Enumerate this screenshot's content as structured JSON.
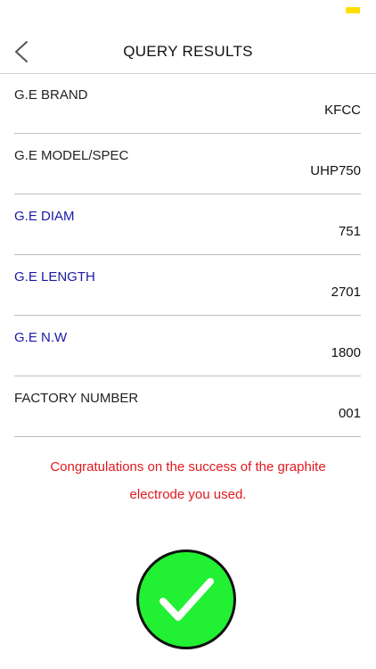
{
  "nav": {
    "title": "QUERY RESULTS",
    "back_icon": "chevron-left-icon"
  },
  "rows": [
    {
      "label": "G.E BRAND",
      "value": "KFCC",
      "label_color": "#222222"
    },
    {
      "label": "G.E MODEL/SPEC",
      "value": "UHP750",
      "label_color": "#222222"
    },
    {
      "label": "G.E DIAM",
      "value": "751",
      "label_color": "#1a1aa6"
    },
    {
      "label": "G.E LENGTH",
      "value": "2701",
      "label_color": "#1a1aa6"
    },
    {
      "label": "G.E N.W",
      "value": "1800",
      "label_color": "#1a1aa6"
    },
    {
      "label": "FACTORY NUMBER",
      "value": "001",
      "label_color": "#222222"
    }
  ],
  "message": {
    "line1": "Congratulations on the success of the graphite",
    "line2": "electrode you used.",
    "color": "#e0191f"
  },
  "success_icon": "check-circle-icon",
  "colors": {
    "success_green": "#22f032",
    "battery_yellow": "#ffdf00"
  }
}
